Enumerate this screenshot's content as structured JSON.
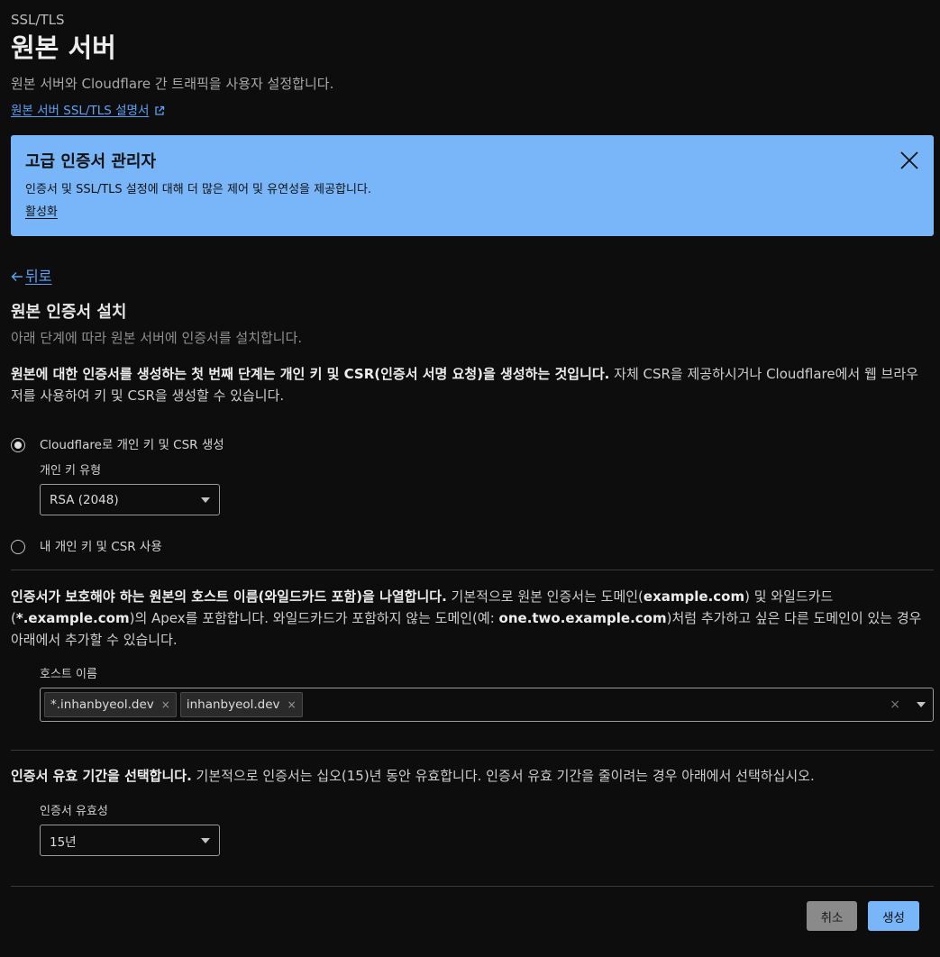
{
  "header": {
    "eyebrow": "SSL/TLS",
    "title": "원본 서버",
    "subtitle": "원본 서버와 Cloudflare 간 트래픽을 사용자 설정합니다.",
    "doc_link": "원본 서버 SSL/TLS 설명서"
  },
  "banner": {
    "title": "고급 인증서 관리자",
    "description": "인증서 및 SSL/TLS 설정에 대해 더 많은 제어 및 유연성을 제공합니다.",
    "action": "활성화"
  },
  "back": "뒤로",
  "section": {
    "title": "원본 인증서 설치",
    "subtitle": "아래 단계에 따라 원본 서버에 인증서를 설치합니다."
  },
  "step1": {
    "bold": "원본에 대한 인증서를 생성하는 첫 번째 단계는 개인 키 및 CSR(인증서 서명 요청)을 생성하는 것입니다.",
    "text": " 자체 CSR을 제공하시거나 Cloudflare에서 웹 브라우저를 사용하여 키 및 CSR을 생성할 수 있습니다."
  },
  "key_options": {
    "option_cloudflare": "Cloudflare로 개인 키 및 CSR 생성",
    "key_type_label": "개인 키 유형",
    "key_type_value": "RSA (2048)",
    "option_own": "내 개인 키 및 CSR 사용"
  },
  "step2": {
    "bold": "인증서가 보호해야 하는 원본의 호스트 이름(와일드카드 포함)을 나열합니다.",
    "t1": " 기본적으로 원본 인증서는 도메인(",
    "b1": "example.com",
    "t2": ") 및 와일드카드(",
    "b2": "*.example.com",
    "t3": ")의 Apex를 포함합니다. 와일드카드가 포함하지 않는 도메인(예: ",
    "b3": "one.two.example.com",
    "t4": ")처럼 추가하고 싶은 다른 도메인이 있는 경우 아래에서 추가할 수 있습니다."
  },
  "hostnames": {
    "label": "호스트 이름",
    "items": [
      "*.inhanbyeol.dev",
      "inhanbyeol.dev"
    ],
    "remove_symbol": "×",
    "clear_symbol": "×"
  },
  "step3": {
    "bold": "인증서 유효 기간을 선택합니다.",
    "text": " 기본적으로 인증서는 십오(15)년 동안 유효합니다. 인증서 유효 기간을 줄이려는 경우 아래에서 선택하십시오."
  },
  "validity": {
    "label": "인증서 유효성",
    "value": "15년"
  },
  "actions": {
    "cancel": "취소",
    "create": "생성"
  },
  "colors": {
    "background": "#0d0d0d",
    "accent_link": "#5ea2f7",
    "banner_bg": "#78b6f9",
    "cancel_bg": "#8a8a8a"
  }
}
